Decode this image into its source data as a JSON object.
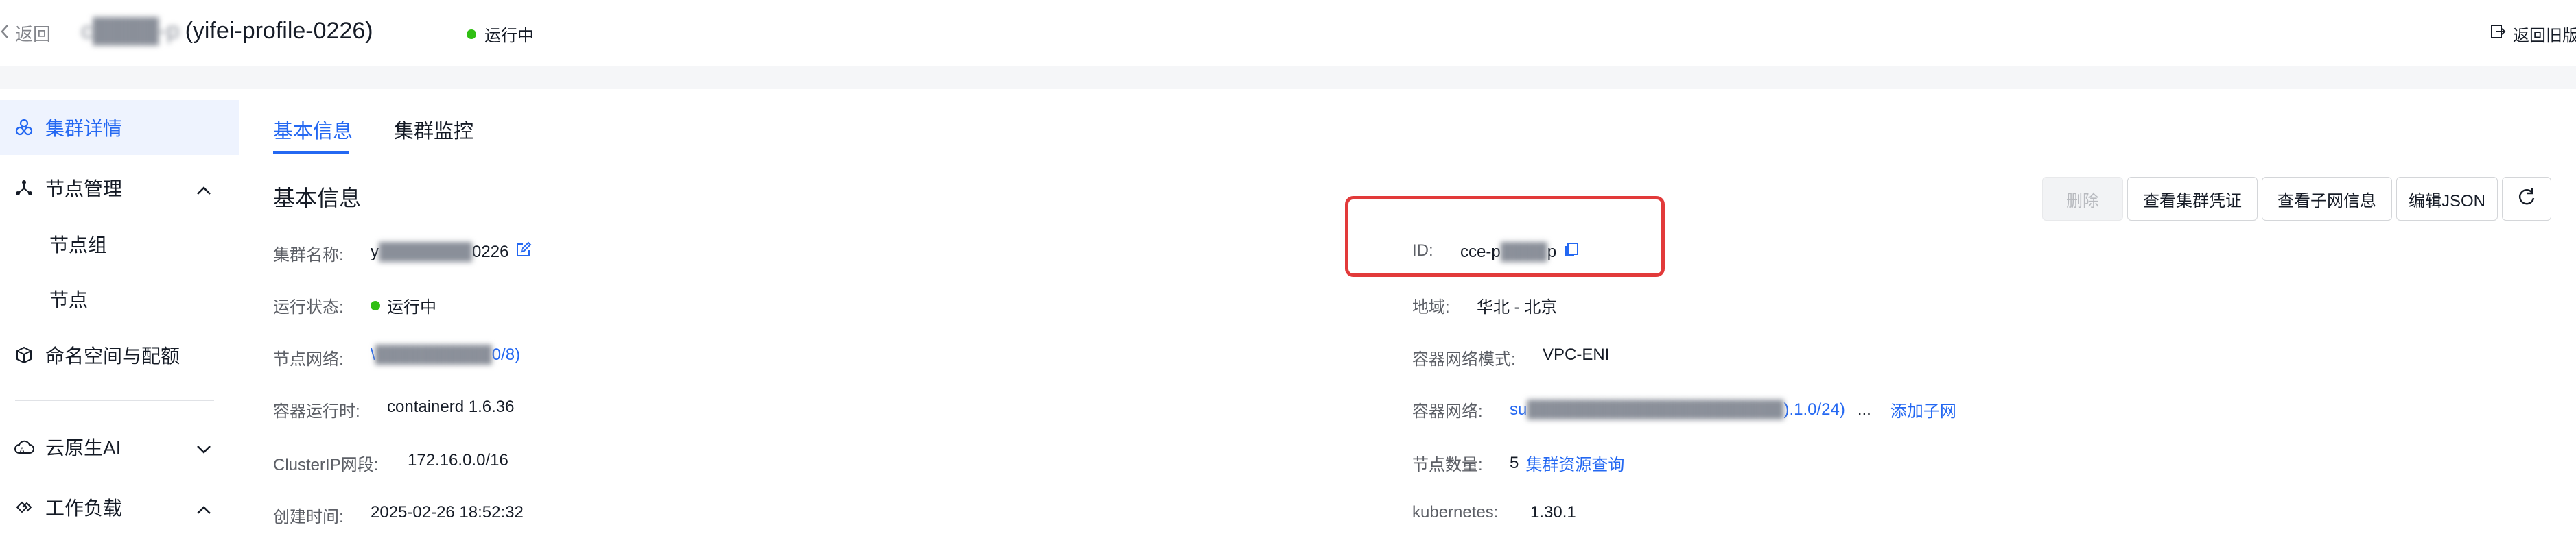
{
  "header": {
    "back_label": "返回",
    "title_redacted": "c████-p",
    "title_suffix": "(yifei-profile-0226)",
    "status": "运行中",
    "return_old": "返回旧版"
  },
  "sidebar": {
    "items": [
      {
        "label": "集群详情"
      },
      {
        "label": "节点管理"
      },
      {
        "label": "节点组"
      },
      {
        "label": "节点"
      },
      {
        "label": "命名空间与配额"
      },
      {
        "label": "云原生AI"
      },
      {
        "label": "工作负载"
      }
    ]
  },
  "tabs": [
    {
      "label": "基本信息"
    },
    {
      "label": "集群监控"
    }
  ],
  "section_title": "基本信息",
  "toolbar": {
    "delete": "删除",
    "view_credentials": "查看集群凭证",
    "view_subnets": "查看子网信息",
    "edit_json": "编辑JSON"
  },
  "left_fields": {
    "cluster_name": {
      "label": "集群名称:",
      "prefix": "y",
      "redacted": "████████",
      "suffix": "0226"
    },
    "status": {
      "label": "运行状态:",
      "value": "运行中"
    },
    "node_network": {
      "label": "节点网络:",
      "prefix": "\\",
      "redacted": "██████████",
      "suffix": "0/8)"
    },
    "runtime": {
      "label": "容器运行时:",
      "value": "containerd 1.6.36"
    },
    "clusterip": {
      "label": "ClusterIP网段:",
      "value": "172.16.0.0/16"
    },
    "created": {
      "label": "创建时间:",
      "value": "2025-02-26 18:52:32"
    }
  },
  "right_fields": {
    "id": {
      "label": "ID:",
      "prefix": "cce-p",
      "redacted": "████",
      "suffix": "p"
    },
    "region": {
      "label": "地域:",
      "value": "华北 - 北京"
    },
    "net_mode": {
      "label": "容器网络模式:",
      "value": "VPC-ENI"
    },
    "container_net": {
      "label": "容器网络:",
      "prefix": "su",
      "redacted": "██████████████████████",
      "suffix": ").1.0/24)",
      "more": "...",
      "add_subnet": "添加子网"
    },
    "node_count": {
      "label": "节点数量:",
      "value": "5",
      "link": "集群资源查询"
    },
    "kubernetes": {
      "label": "kubernetes:",
      "value": "1.30.1"
    }
  },
  "colors": {
    "accent": "#2468f2",
    "status_green": "#30bf13",
    "highlight_red": "#e23a3a"
  }
}
